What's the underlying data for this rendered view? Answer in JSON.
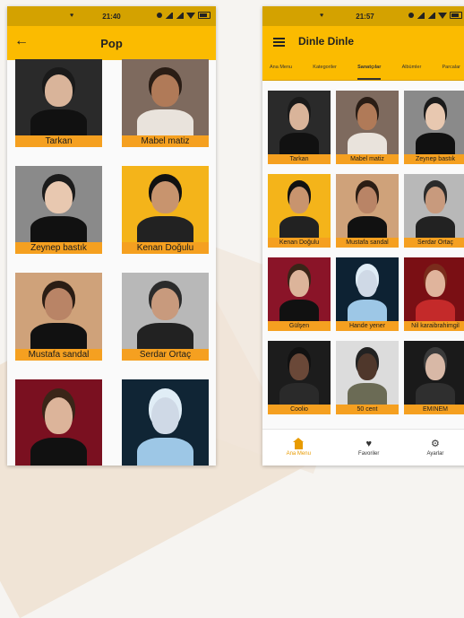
{
  "left_screen": {
    "status_time": "21:40",
    "title": "Pop",
    "artists": [
      {
        "name": "Tarkan",
        "bg": "#2a2a2a",
        "skin": "#d9b49a",
        "hair": "#1a1a1a",
        "shirt": "#111111"
      },
      {
        "name": "Mabel matiz",
        "bg": "#7e6a5e",
        "skin": "#b07a58",
        "hair": "#2a1d15",
        "shirt": "#e9e3dc"
      },
      {
        "name": "Zeynep bastık",
        "bg": "#8a8a8a",
        "skin": "#e8c8b0",
        "hair": "#1b1b1b",
        "shirt": "#111111"
      },
      {
        "name": "Kenan Doğulu",
        "bg": "#f4b41a",
        "skin": "#c8946e",
        "hair": "#111111",
        "shirt": "#222222"
      },
      {
        "name": "Mustafa sandal",
        "bg": "#cfa27a",
        "skin": "#b98466",
        "hair": "#2b1d14",
        "shirt": "#111111"
      },
      {
        "name": "Serdar Ortaç",
        "bg": "#b8b8b8",
        "skin": "#c89a7d",
        "hair": "#2b2b2b",
        "shirt": "#222222"
      },
      {
        "name": "",
        "bg": "#7a1020",
        "skin": "#dcb49a",
        "hair": "#3a2518",
        "shirt": "#111111"
      },
      {
        "name": "",
        "bg": "#102535",
        "skin": "#cfd9e6",
        "hair": "#e0edf6",
        "shirt": "#9dc7e6"
      }
    ]
  },
  "right_screen": {
    "status_time": "21:57",
    "title": "Dinle Dinle",
    "tabs": [
      "Ana Menu",
      "Kategoriler",
      "Sanatçılar",
      "Albümler",
      "Parcalar"
    ],
    "active_tab": "Sanatçılar",
    "artists": [
      {
        "name": "Tarkan",
        "bg": "#2a2a2a",
        "skin": "#d9b49a",
        "hair": "#1a1a1a",
        "shirt": "#111111"
      },
      {
        "name": "Mabel matiz",
        "bg": "#7e6a5e",
        "skin": "#b07a58",
        "hair": "#2a1d15",
        "shirt": "#e9e3dc"
      },
      {
        "name": "Zeynep bastık",
        "bg": "#8a8a8a",
        "skin": "#e8c8b0",
        "hair": "#1b1b1b",
        "shirt": "#111111"
      },
      {
        "name": "Kenan Doğulu",
        "bg": "#f4b41a",
        "skin": "#c8946e",
        "hair": "#111111",
        "shirt": "#222222"
      },
      {
        "name": "Mustafa sandal",
        "bg": "#cfa27a",
        "skin": "#b98466",
        "hair": "#2b1d14",
        "shirt": "#111111"
      },
      {
        "name": "Serdar Ortaç",
        "bg": "#b8b8b8",
        "skin": "#c89a7d",
        "hair": "#2b2b2b",
        "shirt": "#222222"
      },
      {
        "name": "Gülşen",
        "bg": "#8a1428",
        "skin": "#dcb49a",
        "hair": "#3a2518",
        "shirt": "#111111"
      },
      {
        "name": "Hande yener",
        "bg": "#0d2233",
        "skin": "#cfd9e6",
        "hair": "#e0edf6",
        "shirt": "#9dc7e6"
      },
      {
        "name": "Nil karaibrahimgil",
        "bg": "#7a0f14",
        "skin": "#e0b49c",
        "hair": "#7a2c1c",
        "shirt": "#c42a2a"
      },
      {
        "name": "Coolio",
        "bg": "#1c1c1c",
        "skin": "#6a4838",
        "hair": "#111111",
        "shirt": "#2a2a2a"
      },
      {
        "name": "50 cent",
        "bg": "#dcdcdc",
        "skin": "#4f372b",
        "hair": "#222222",
        "shirt": "#6b6b55"
      },
      {
        "name": "EMINEM",
        "bg": "#1a1a1a",
        "skin": "#d8b8a6",
        "hair": "#3a3a3a",
        "shirt": "#2f2f2f"
      }
    ],
    "bottom_nav": [
      {
        "label": "Ana Menu",
        "icon": "home-icon",
        "active": true
      },
      {
        "label": "Favoriler",
        "icon": "heart-icon",
        "active": false
      },
      {
        "label": "Ayarlar",
        "icon": "gear-icon",
        "active": false
      }
    ]
  },
  "colors": {
    "app_bar": "#fbbb00",
    "status_bar": "#d4a200",
    "caption": "#f5a020",
    "active_nav": "#e89b00"
  }
}
